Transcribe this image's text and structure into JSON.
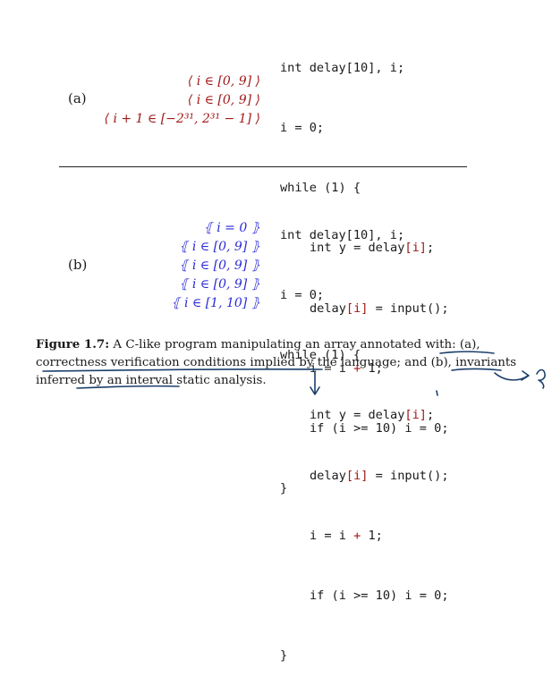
{
  "panel_a": {
    "label": "(a)",
    "annotations": [
      "⟨ i ∈ [0, 9] ⟩",
      "⟨ i ∈ [0, 9] ⟩",
      "⟨ i + 1 ∈ [−2³¹, 2³¹ − 1] ⟩"
    ],
    "code": {
      "decl": "int delay[10], i;",
      "init": "i = 0;",
      "loop": "while (1) {",
      "l1_a": "int y = delay",
      "l1_b": "[i]",
      "l1_c": ";",
      "l2_a": "delay",
      "l2_b": "[i]",
      "l2_c": " = input();",
      "l3_a": "i = i ",
      "l3_b": "+",
      "l3_c": " 1;",
      "l4": "if (i >= 10) i = 0;",
      "close": "}"
    }
  },
  "panel_b": {
    "label": "(b)",
    "annotations": [
      "⦃ i = 0 ⦄",
      "⦃ i ∈ [0, 9] ⦄",
      "⦃ i ∈ [0, 9] ⦄",
      "⦃ i ∈ [0, 9] ⦄",
      "⦃ i ∈ [1, 10] ⦄"
    ],
    "code": {
      "decl": "int delay[10], i;",
      "init": "i = 0;",
      "loop": "while (1) {",
      "l1_a": "int y = delay",
      "l1_b": "[i]",
      "l1_c": ";",
      "l2_a": "delay",
      "l2_b": "[i]",
      "l2_c": " = input();",
      "l3_a": "i = i ",
      "l3_b": "+",
      "l3_c": " 1;",
      "l4": "if (i >= 10) i = 0;",
      "close": "}"
    }
  },
  "caption": {
    "figure": "Figure 1.7:",
    "text": " A C-like program manipulating an array annotated with: (a), correctness verification conditions implied by the language; and (b), invariants inferred by an interval static analysis."
  },
  "colors": {
    "red": "#a01818",
    "blue": "#2a2ad6",
    "ink": "#1c3f6b"
  }
}
